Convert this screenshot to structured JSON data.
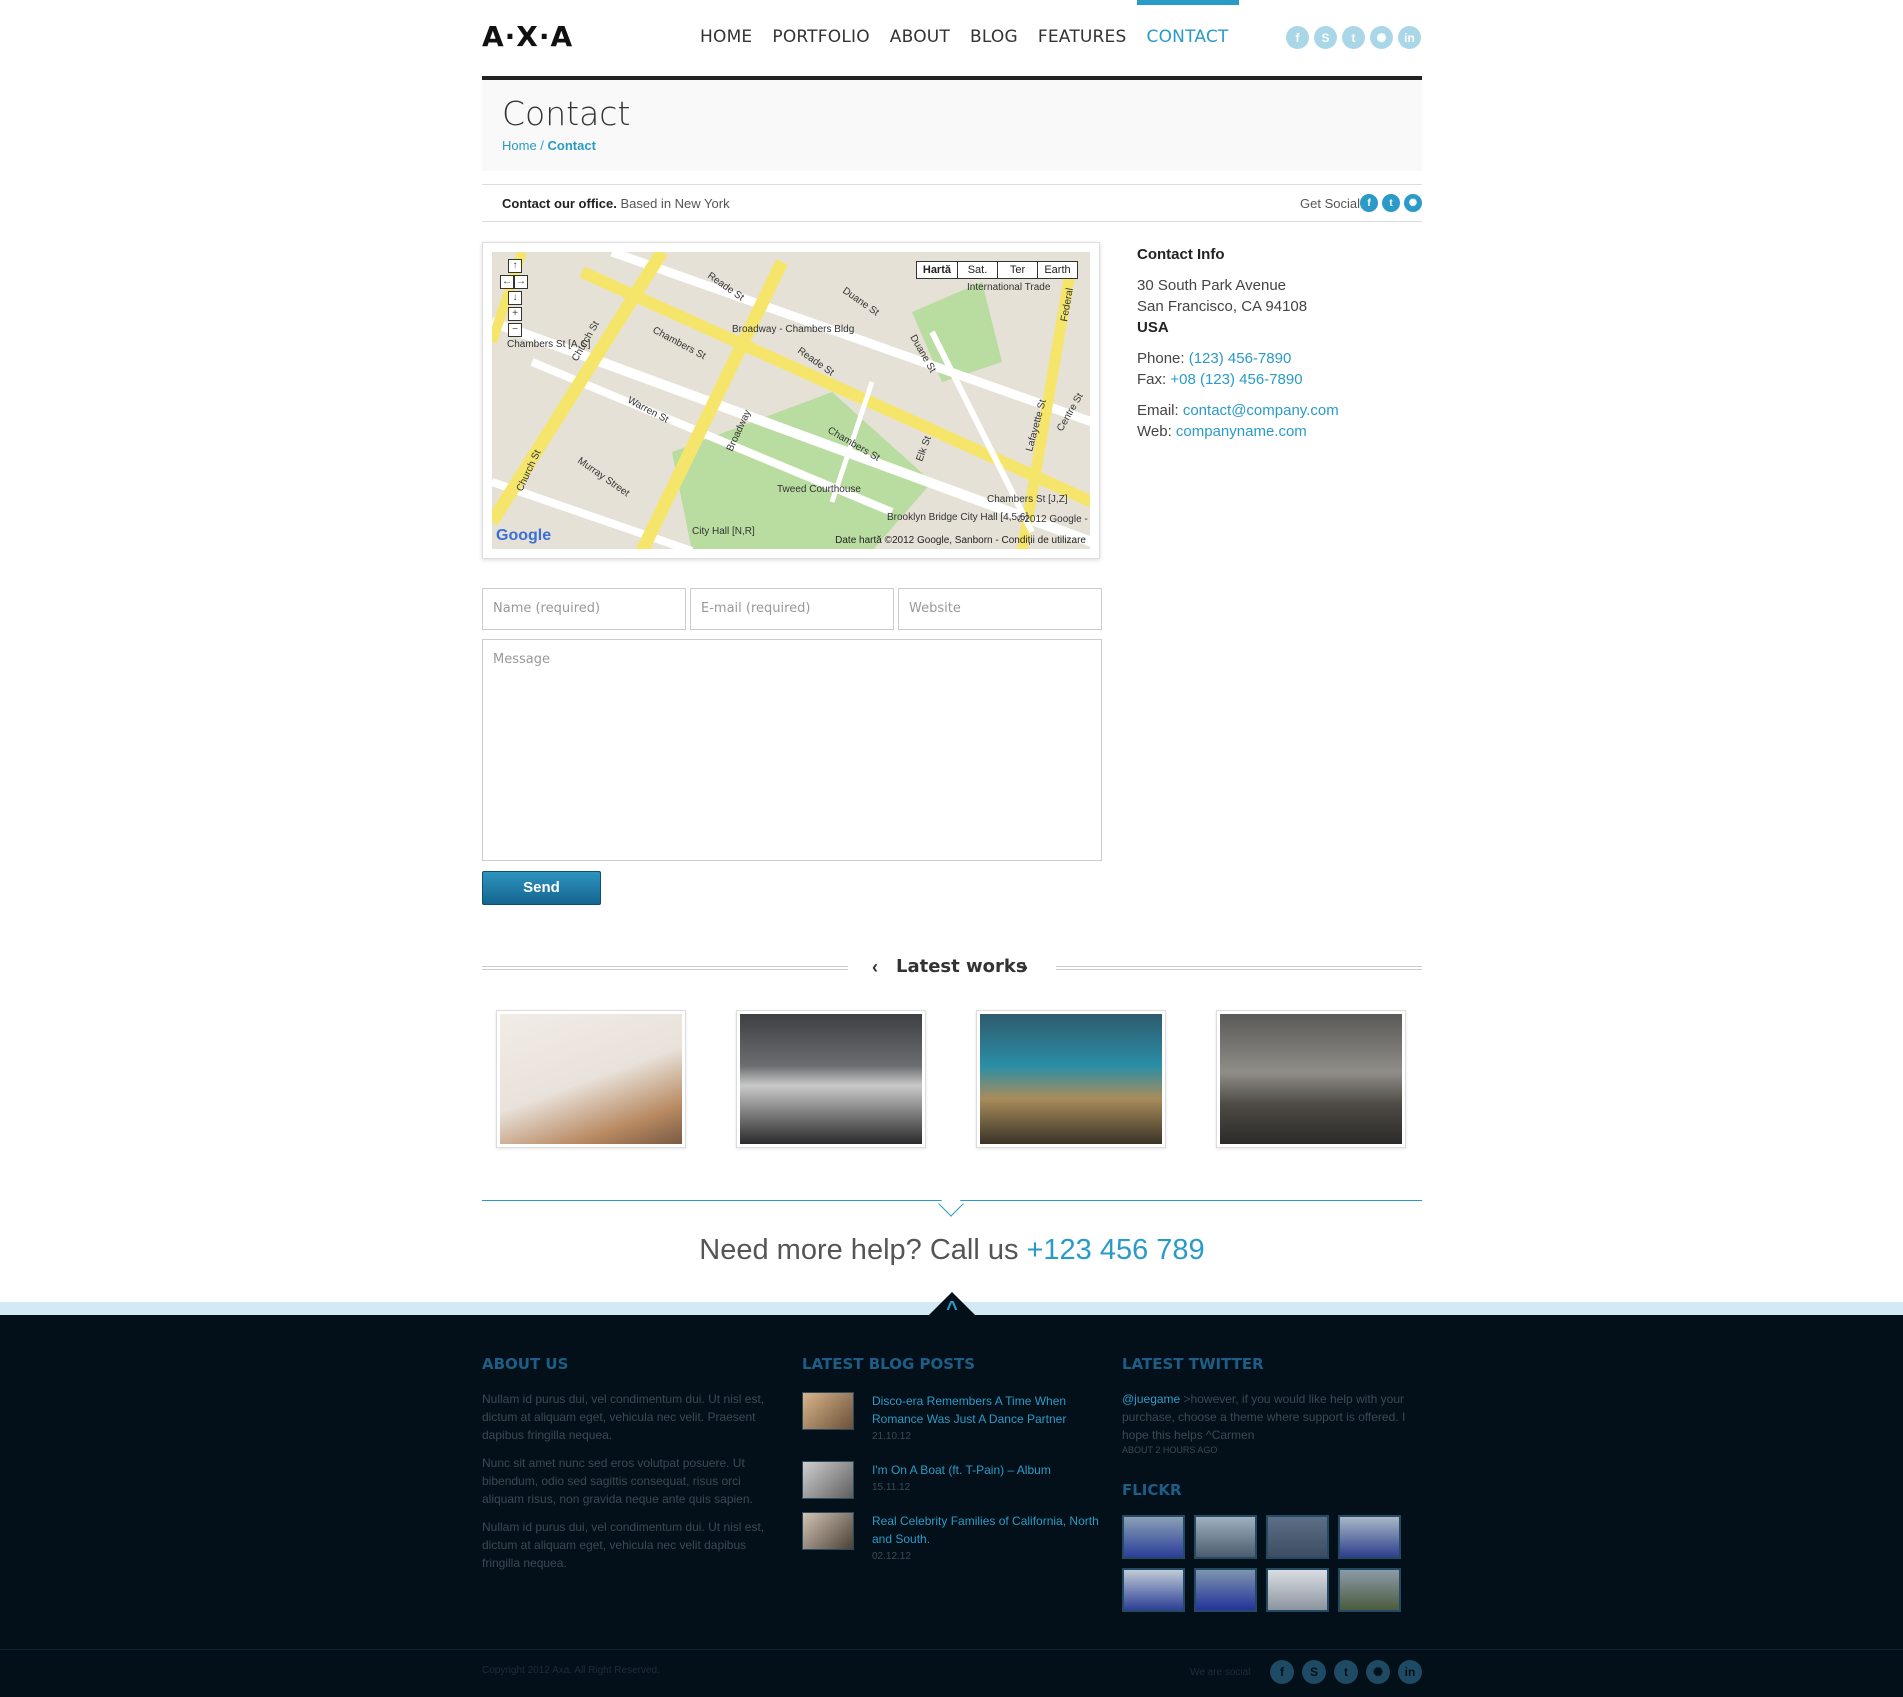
{
  "header": {
    "logo": "A·X·A",
    "nav": [
      "HOME",
      "PORTFOLIO",
      "ABOUT",
      "BLOG",
      "FEATURES",
      "CONTACT"
    ],
    "active_nav": "CONTACT",
    "social_icons": [
      "facebook-icon",
      "skype-icon",
      "twitter-icon",
      "dribbble-icon",
      "linkedin-icon"
    ]
  },
  "page": {
    "title": "Contact",
    "breadcrumb_home": "Home",
    "breadcrumb_sep": " / ",
    "breadcrumb_current": "Contact",
    "info_bold": "Contact our office.",
    "info_rest": " Based in New York",
    "get_social": "Get Social"
  },
  "map": {
    "types": [
      "Hartă",
      "Sat.",
      "Ter",
      "Earth"
    ],
    "copyright": "Date hartă ©2012 Google, Sanborn - Condiții de utilizare",
    "google": "Google",
    "labels": [
      "Chambers St",
      "Church St",
      "Reade St",
      "Warren St",
      "Broadway",
      "Murray Street",
      "Duane St",
      "Chambers St",
      "Elk St",
      "Lafayette St",
      "Centre St",
      "Federal",
      "Tweed Courthouse",
      "International Trade",
      "Broadway - Chambers Bldg",
      "City Hall [N,R]",
      "Brooklyn Bridge City Hall [4,5,6]",
      "Chambers St [A,C]",
      "Chambers St [J,Z]",
      "©2012 Google -"
    ]
  },
  "contact_info": {
    "heading": "Contact Info",
    "street": "30 South Park Avenue",
    "city": "San Francisco, CA 94108",
    "country": "USA",
    "phone_label": "Phone: ",
    "phone": "(123) 456-7890",
    "fax_label": "Fax: ",
    "fax": "+08 (123) 456-7890",
    "email_label": "Email: ",
    "email": "contact@company.com",
    "web_label": "Web: ",
    "web": "companyname.com"
  },
  "form": {
    "name_placeholder": "Name (required)",
    "email_placeholder": "E-mail (required)",
    "website_placeholder": "Website",
    "message_placeholder": "Message",
    "send_label": "Send"
  },
  "latest_works": {
    "title": "Latest works",
    "prev": "‹",
    "next": "›"
  },
  "help": {
    "text": "Need more help? Call us",
    "phone": "+123 456 789"
  },
  "footer": {
    "about_heading": "ABOUT US",
    "about_paragraphs": [
      "Nullam id purus dui, vel condimentum dui. Ut nisl est, dictum at aliquam eget, vehicula nec velit. Praesent dapibus fringilla nequea.",
      "Nunc sit amet nunc sed eros volutpat posuere. Ut bibendum, odio sed sagittis consequat, risus orci aliquam risus, non gravida neque ante quis sapien.",
      "Nullam id purus dui, vel condimentum dui. Ut nisl est, dictum at aliquam eget, vehicula nec velit dapibus fringilla nequea."
    ],
    "blog_heading": "LATEST BLOG POSTS",
    "blog_posts": [
      {
        "title": "Disco-era Remembers A Time When Romance Was Just A Dance Partner",
        "date": "21.10.12"
      },
      {
        "title": "I'm On A Boat (ft. T-Pain) – Album",
        "date": "15.11.12"
      },
      {
        "title": "Real Celebrity Families of California, North and South.",
        "date": "02.12.12"
      }
    ],
    "twitter_heading": "LATEST TWITTER",
    "tweet_user": "@juegame",
    "tweet_text": " >however, if you would like help with your purchase, choose a theme where support is offered. I hope this helps ^Carmen",
    "tweet_ago": "ABOUT 2 HOURS AGO",
    "flickr_heading": "FLICKR",
    "copyright": "Copyright 2012 Axa. All Right Reserved.",
    "we_are_social": "We are social"
  }
}
